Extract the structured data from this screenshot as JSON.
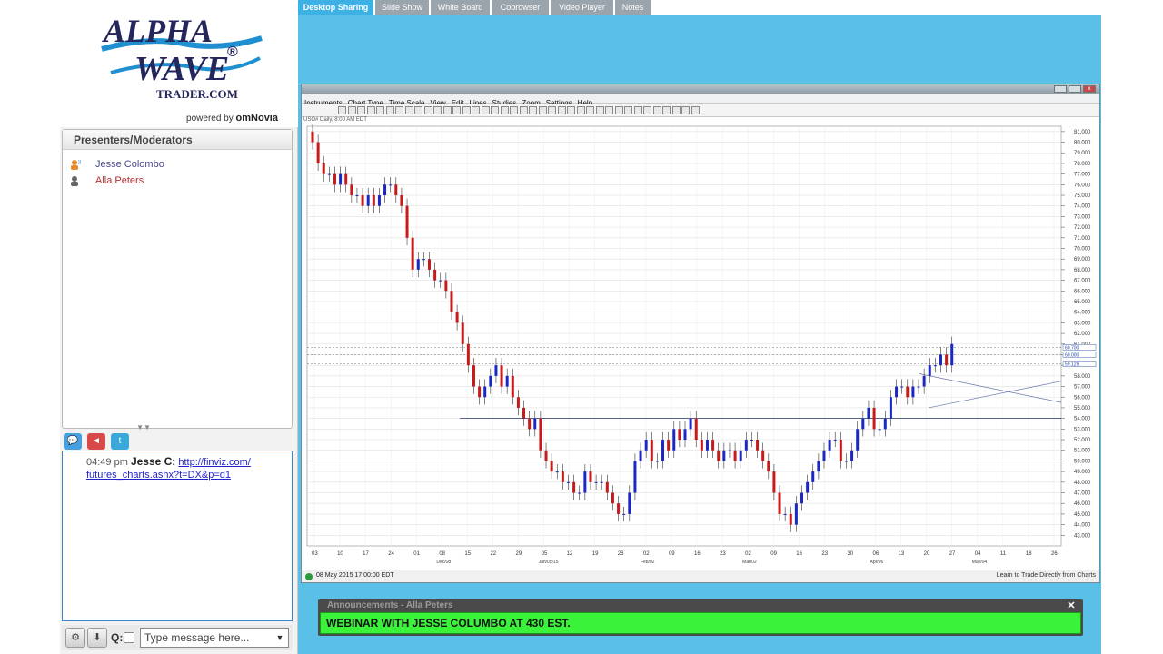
{
  "brand": {
    "logo_line1": "ALPHA",
    "logo_line2": "WAVE",
    "logo_line3": "TRADER.COM",
    "registered": "®",
    "powered_by_label": "powered by",
    "powered_by_brand": "omNovia"
  },
  "presenters": {
    "header": "Presenters/Moderators",
    "items": [
      {
        "name": "Jesse Colombo",
        "icon": "speaking-user-icon"
      },
      {
        "name": "Alla Peters",
        "icon": "user-icon"
      }
    ]
  },
  "chat": {
    "tabs": [
      "chat-icon",
      "qa-icon",
      "twitter-icon"
    ],
    "messages": [
      {
        "time": "04:49 pm",
        "author": "Jesse C:",
        "link": "http://finviz.com/ futures_charts.ashx?t=DX&p=d1"
      }
    ],
    "input_placeholder": "Type message here...",
    "q_label": "Q:"
  },
  "tabs": [
    {
      "label": "Desktop Sharing",
      "active": true
    },
    {
      "label": "Slide Show",
      "active": false
    },
    {
      "label": "White Board",
      "active": false
    },
    {
      "label": "Cobrowser",
      "active": false
    },
    {
      "label": "Video Player",
      "active": false
    },
    {
      "label": "Notes",
      "active": false
    }
  ],
  "chart_window": {
    "menu": [
      "Instruments",
      "Chart Type",
      "Time Scale",
      "View",
      "Edit",
      "Lines",
      "Studies",
      "Zoom",
      "Settings",
      "Help"
    ],
    "symbol": "USO# Daily, 8:00 AM EDT",
    "status_time": "08 May 2015 17:00:00 EDT",
    "learn_link": "Learn to Trade Directly from Charts"
  },
  "announcement": {
    "title": "Announcements - Alla Peters",
    "message": "WEBINAR WITH JESSE COLUMBO AT 430 EST."
  },
  "chart_data": {
    "type": "candlestick",
    "y_ticks": [
      "81.000",
      "80.000",
      "79.000",
      "78.000",
      "77.000",
      "76.000",
      "75.000",
      "74.000",
      "73.000",
      "72.000",
      "71.000",
      "70.000",
      "69.000",
      "68.000",
      "67.000",
      "66.000",
      "65.000",
      "64.000",
      "63.000",
      "62.000",
      "61.000",
      "60.000",
      "59.000",
      "58.000",
      "57.000",
      "56.000",
      "55.000",
      "54.000",
      "53.000",
      "52.000",
      "51.000",
      "50.000",
      "49.000",
      "48.000",
      "47.000",
      "46.000",
      "45.000",
      "44.000",
      "43.000"
    ],
    "x_ticks": [
      "03",
      "10",
      "17",
      "24",
      "01",
      "08",
      "15",
      "22",
      "29",
      "05",
      "12",
      "19",
      "26",
      "02",
      "09",
      "16",
      "23",
      "02",
      "09",
      "16",
      "23",
      "30",
      "06",
      "13",
      "20",
      "27",
      "04",
      "11",
      "18",
      "26"
    ],
    "x_months": [
      "Dec/08",
      "Jan/05/15",
      "Feb/02",
      "Mar/02",
      "Apr/06",
      "May/04"
    ],
    "ylim": [
      42,
      81.5
    ],
    "price_labels": [
      "60.700",
      "60.000",
      "59.129"
    ],
    "closes": [
      80,
      78,
      77,
      77,
      76,
      77,
      76,
      75,
      75,
      74,
      75,
      74,
      75,
      76,
      76,
      75,
      74,
      71,
      68,
      69,
      69,
      68,
      67,
      67,
      66,
      64,
      63,
      61,
      59,
      57,
      56,
      57,
      58,
      59,
      57,
      58,
      56,
      55,
      54,
      53,
      54,
      51,
      50,
      49,
      49,
      48,
      48,
      47,
      47,
      49,
      48,
      48,
      48,
      47,
      46,
      45,
      45,
      47,
      50,
      51,
      52,
      50,
      50,
      52,
      51,
      53,
      52,
      53,
      54,
      52,
      51,
      52,
      51,
      50,
      51,
      51,
      50,
      51,
      52,
      52,
      51,
      50,
      49,
      47,
      45,
      45,
      44,
      46,
      47,
      48,
      49,
      50,
      51,
      52,
      52,
      50,
      50,
      51,
      53,
      54,
      55,
      53,
      53,
      54,
      56,
      57,
      57,
      56,
      57,
      57,
      58,
      59,
      59,
      60,
      59,
      61
    ]
  }
}
